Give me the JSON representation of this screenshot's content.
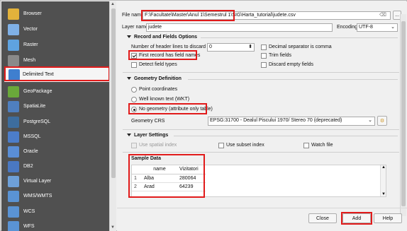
{
  "sidebar": {
    "items": [
      {
        "label": "Browser",
        "icon": "browser-icon",
        "color": "#e2b23b"
      },
      {
        "label": "Vector",
        "icon": "vector-icon",
        "color": "#7fb0e6"
      },
      {
        "label": "Raster",
        "icon": "raster-icon",
        "color": "#5fa3e0"
      },
      {
        "label": "Mesh",
        "icon": "mesh-icon",
        "color": "#8a8a8a"
      },
      {
        "label": "Delimited Text",
        "icon": "delimited-text-icon",
        "color": "#3f7fcf"
      },
      {
        "label": "GeoPackage",
        "icon": "geopackage-icon",
        "color": "#6aa83a"
      },
      {
        "label": "SpatiaLite",
        "icon": "spatialite-icon",
        "color": "#4f7fbf"
      },
      {
        "label": "PostgreSQL",
        "icon": "postgresql-icon",
        "color": "#3d6d9e"
      },
      {
        "label": "MSSQL",
        "icon": "mssql-icon",
        "color": "#4c7dc9"
      },
      {
        "label": "Oracle",
        "icon": "oracle-icon",
        "color": "#5a8ed6"
      },
      {
        "label": "DB2",
        "icon": "db2-icon",
        "color": "#4a78c2"
      },
      {
        "label": "Virtual Layer",
        "icon": "virtual-layer-icon",
        "color": "#6ea0d8"
      },
      {
        "label": "WMS/WMTS",
        "icon": "wms-icon",
        "color": "#5a93d4"
      },
      {
        "label": "WCS",
        "icon": "wcs-icon",
        "color": "#5a93d4"
      },
      {
        "label": "WFS",
        "icon": "wfs-icon",
        "color": "#5a93d4"
      }
    ]
  },
  "form": {
    "file_name_label": "File name",
    "file_name_value": "F:\\Facultate\\Master\\Anul 1\\Semestrul 1\\SIG\\Harta_tutorial\\judete.csv",
    "browse_label": "...",
    "layer_name_label": "Layer name",
    "layer_name_value": "judete",
    "encoding_label": "Encoding",
    "encoding_value": "UTF-8"
  },
  "record": {
    "title": "Record and Fields Options",
    "header_lines_label": "Number of header lines to discard",
    "header_lines_value": "0",
    "decimal_comma": "Decimal separator is comma",
    "first_record": "First record has field names",
    "trim_fields": "Trim fields",
    "detect_types": "Detect field types",
    "discard_empty": "Discard empty fields"
  },
  "geometry": {
    "title": "Geometry Definition",
    "point": "Point coordinates",
    "wkt": "Well known text (WKT)",
    "none": "No geometry (attribute only table)",
    "crs_label": "Geometry CRS",
    "crs_value": "EPSG:31700 - Dealul Piscului 1970/ Stereo 70 (deprecated)"
  },
  "layer_settings": {
    "title": "Layer Settings",
    "spatial_index": "Use spatial index",
    "subset_index": "Use subset index",
    "watch_file": "Watch file"
  },
  "sample": {
    "title": "Sample Data",
    "columns": [
      "name",
      "Vizitatori"
    ],
    "rows": [
      {
        "n": "1",
        "name": "Alba",
        "v": "280064"
      },
      {
        "n": "2",
        "name": "Arad",
        "v": "64239"
      }
    ]
  },
  "buttons": {
    "close": "Close",
    "add": "Add",
    "help": "Help"
  },
  "colors": {
    "highlight": "#e11b1b",
    "sidebar_bg": "#505050"
  }
}
